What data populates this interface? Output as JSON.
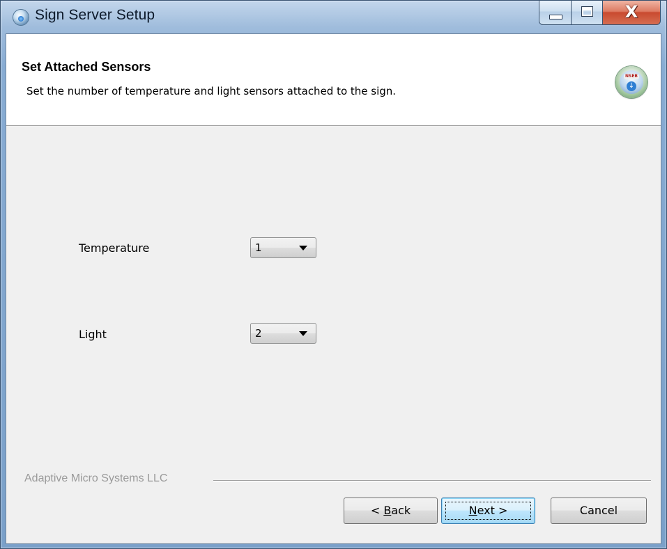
{
  "window": {
    "title": "Sign Server Setup",
    "icon": "setup-globe-icon",
    "controls": {
      "minimize": "minimize-icon",
      "maximize": "maximize-icon",
      "close": "X"
    }
  },
  "header": {
    "title": "Set Attached Sensors",
    "subtitle": "Set the number of temperature and light sensors attached to the sign.",
    "icon": "installer-globe-icon",
    "icon_badge": "NSEB"
  },
  "fields": [
    {
      "label": "Temperature",
      "value": "1"
    },
    {
      "label": "Light",
      "value": "2"
    }
  ],
  "footer": {
    "brand": "Adaptive Micro Systems LLC",
    "buttons": {
      "back": {
        "prefix": "< ",
        "accel": "B",
        "rest": "ack"
      },
      "next": {
        "accel": "N",
        "rest": "ext >"
      },
      "cancel": "Cancel"
    }
  }
}
